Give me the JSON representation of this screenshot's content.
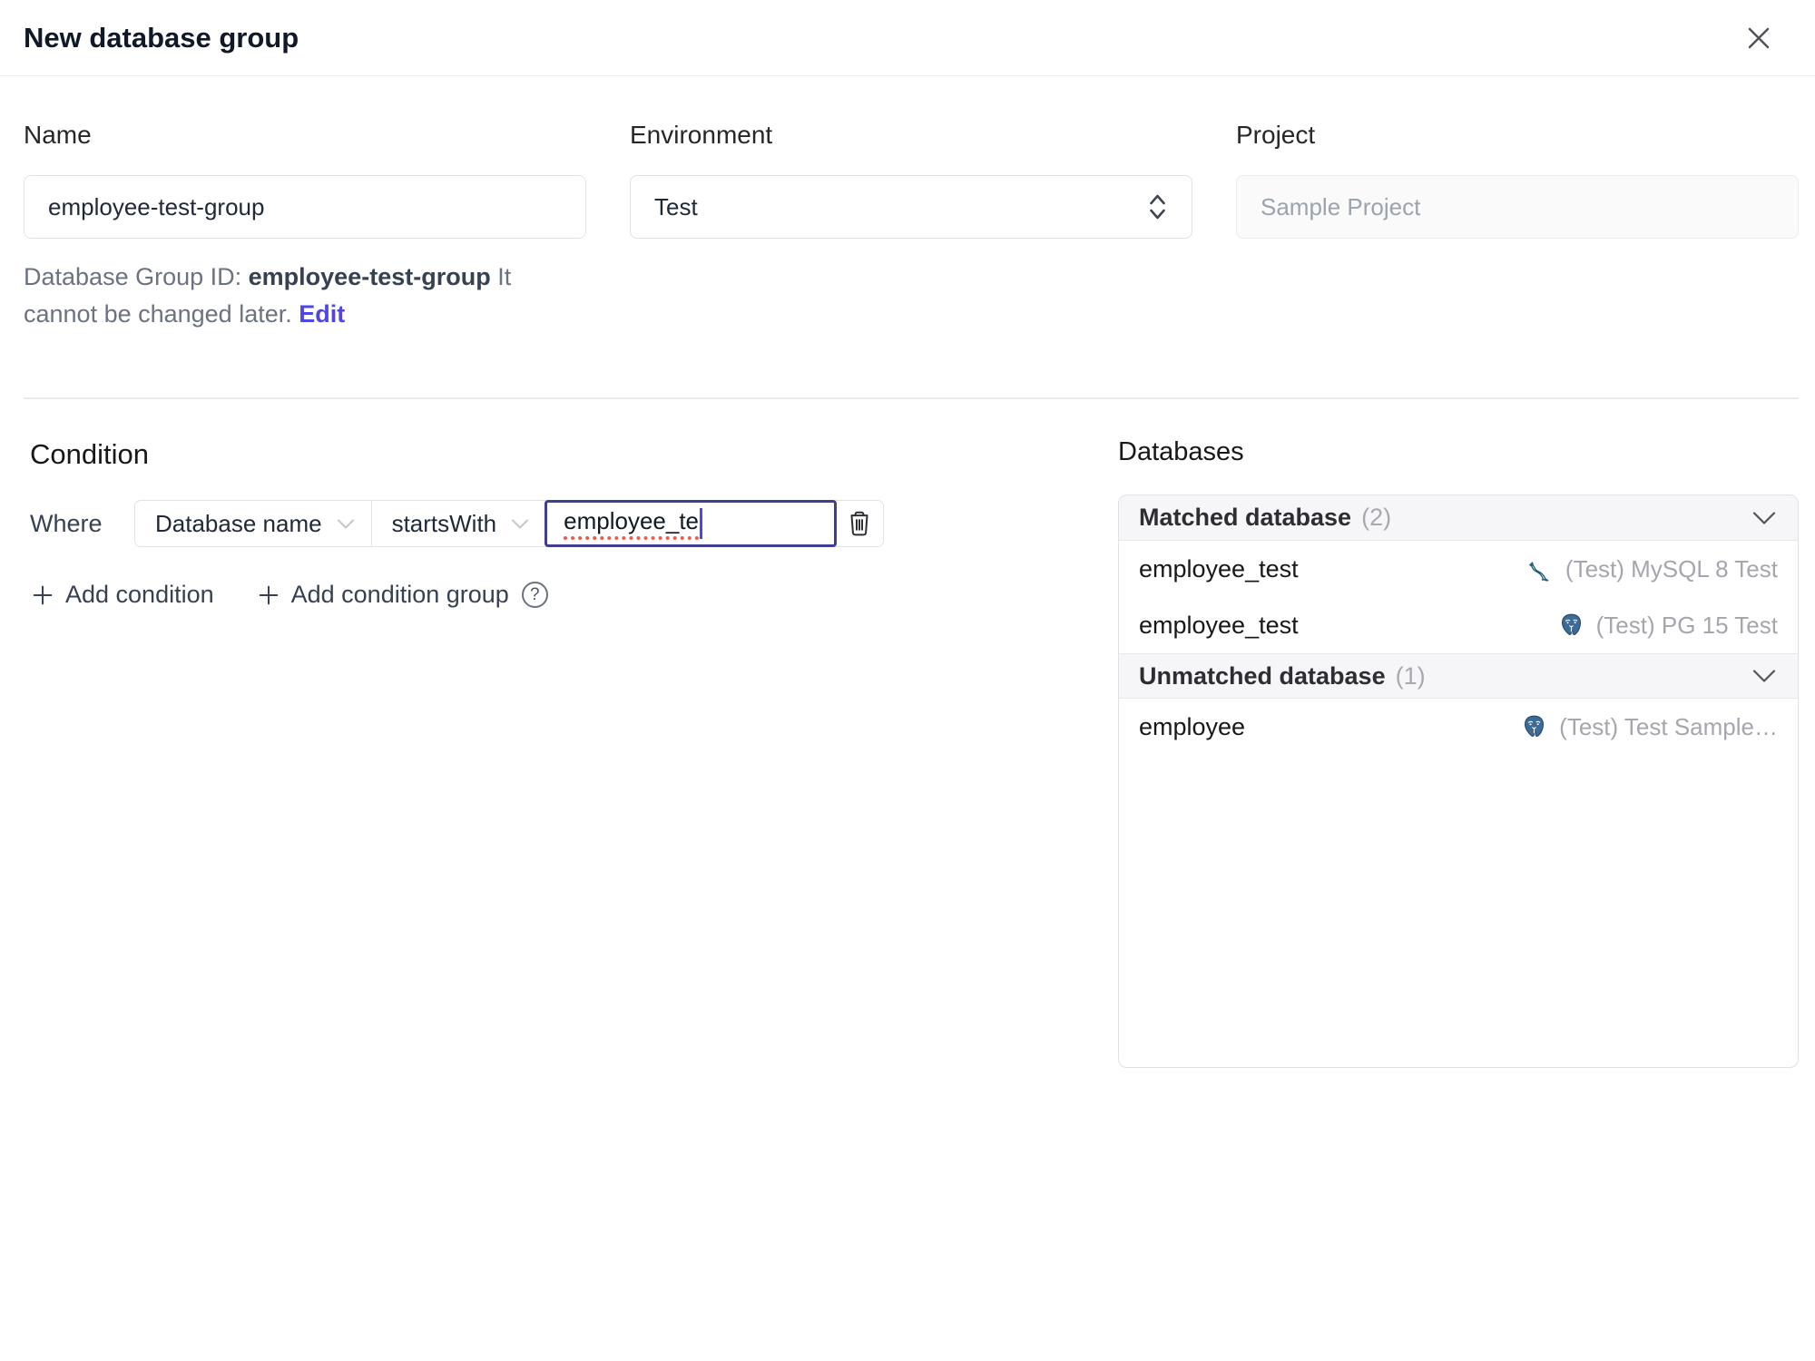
{
  "dialog": {
    "title": "New database group"
  },
  "form": {
    "name": {
      "label": "Name",
      "value": "employee-test-group"
    },
    "environment": {
      "label": "Environment",
      "value": "Test"
    },
    "project": {
      "label": "Project",
      "value": "Sample Project"
    },
    "id_hint": {
      "prefix": "Database Group ID:",
      "id": "employee-test-group",
      "note": "It cannot be changed later.",
      "edit_label": "Edit"
    }
  },
  "condition": {
    "heading": "Condition",
    "where_label": "Where",
    "factor": "Database name",
    "operator": "startsWith",
    "value": "employee_te",
    "add_condition_label": "Add condition",
    "add_condition_group_label": "Add condition group"
  },
  "databases": {
    "heading": "Databases",
    "matched": {
      "title": "Matched database",
      "count": "(2)",
      "rows": [
        {
          "name": "employee_test",
          "engine": "mysql",
          "instance": "(Test) MySQL 8 Test"
        },
        {
          "name": "employee_test",
          "engine": "postgresql",
          "instance": "(Test) PG 15 Test"
        }
      ]
    },
    "unmatched": {
      "title": "Unmatched database",
      "count": "(1)",
      "rows": [
        {
          "name": "employee",
          "engine": "postgresql",
          "instance": "(Test) Test Sample…"
        }
      ]
    }
  },
  "colors": {
    "accent": "#4f46e5",
    "focus_border": "#3f3d94",
    "spellcheck_red": "#f0594f",
    "muted_text": "#a6a6ae",
    "section_header_bg": "#f6f6f8",
    "mysql_teal": "#1e5b79",
    "postgres_blue": "#3d6a96"
  }
}
